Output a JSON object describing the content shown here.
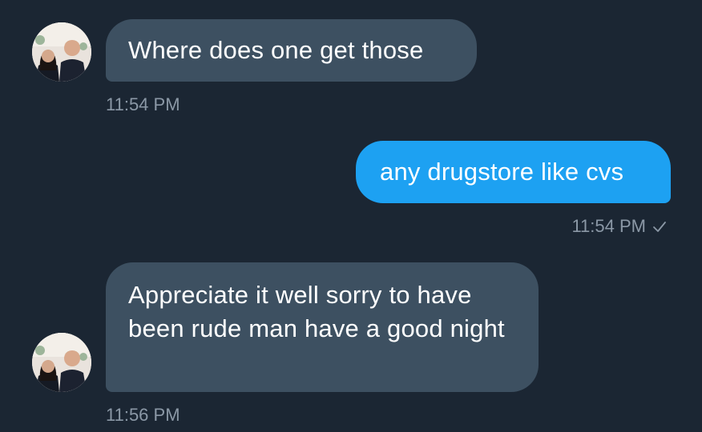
{
  "colors": {
    "background": "#1b2633",
    "incoming_bubble": "#3d5061",
    "outgoing_bubble": "#1da1f2",
    "timestamp": "#8b98a6"
  },
  "messages": [
    {
      "direction": "incoming",
      "text": "Where does one get those",
      "time": "11:54 PM",
      "avatar": "contact-avatar-photo"
    },
    {
      "direction": "outgoing",
      "text": "any drugstore like cvs",
      "time": "11:54 PM",
      "status_icon": "checkmark-icon"
    },
    {
      "direction": "incoming",
      "text": "Appreciate it well sorry to have been rude man have a good night",
      "time": "11:56 PM",
      "avatar": "contact-avatar-photo"
    }
  ]
}
